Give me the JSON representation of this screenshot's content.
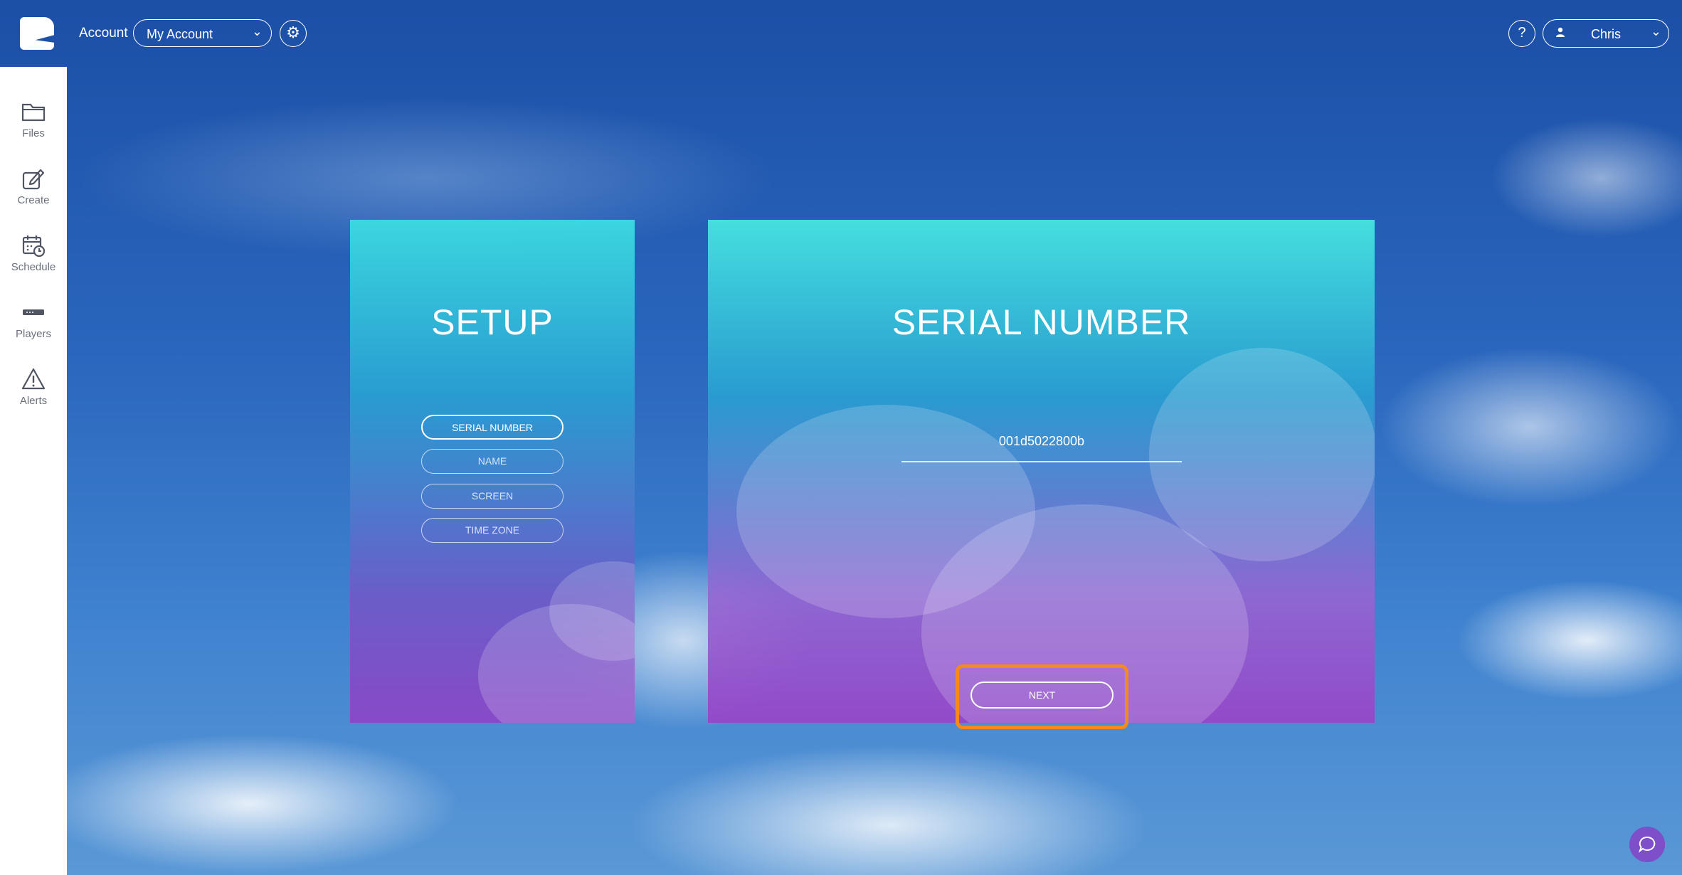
{
  "header": {
    "account_label": "Account",
    "account_select_value": "My Account",
    "help_label": "?",
    "user_name": "Chris"
  },
  "sidebar": {
    "items": [
      {
        "label": "Files",
        "icon": "folder-icon"
      },
      {
        "label": "Create",
        "icon": "create-edit-icon"
      },
      {
        "label": "Schedule",
        "icon": "calendar-clock-icon"
      },
      {
        "label": "Players",
        "icon": "player-device-icon"
      },
      {
        "label": "Alerts",
        "icon": "warning-triangle-icon"
      }
    ]
  },
  "setup": {
    "title": "SETUP",
    "steps": [
      {
        "label": "SERIAL NUMBER",
        "active": true
      },
      {
        "label": "NAME",
        "active": false
      },
      {
        "label": "SCREEN",
        "active": false
      },
      {
        "label": "TIME ZONE",
        "active": false
      }
    ]
  },
  "serial": {
    "title": "SERIAL NUMBER",
    "value": "001d5022800b",
    "next_label": "NEXT"
  },
  "colors": {
    "highlight": "#f28a1e",
    "chat_button": "#7d4fc9",
    "sidebar_bg": "#ffffff"
  }
}
